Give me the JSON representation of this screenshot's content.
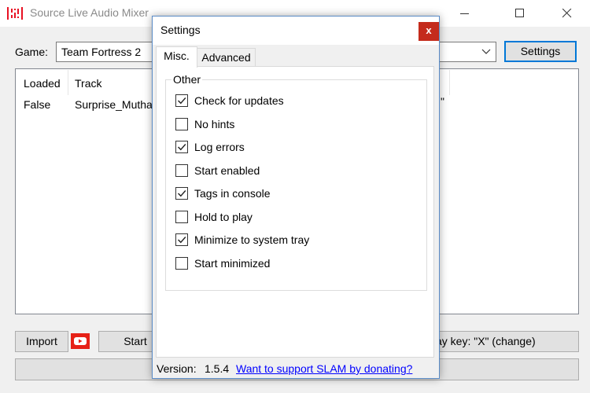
{
  "app": {
    "title": "Source Live Audio Mixer"
  },
  "main": {
    "game_label": "Game:",
    "game_value": "Team Fortress 2",
    "settings_button": "Settings",
    "track_list": {
      "headers": [
        "Loaded",
        "Track"
      ],
      "rows": [
        {
          "loaded": "False",
          "track": "Surprise_Muthaf",
          "trailing": "\""
        }
      ]
    },
    "import_button": "Import",
    "start_button": "Start",
    "relay_key": "ay key: \"X\" (change)"
  },
  "dialog": {
    "title": "Settings",
    "close_glyph": "x",
    "tabs": [
      "Misc.",
      "Advanced"
    ],
    "group_title": "Other",
    "options": [
      {
        "label": "Check for updates",
        "checked": true
      },
      {
        "label": "No hints",
        "checked": false
      },
      {
        "label": "Log errors",
        "checked": true
      },
      {
        "label": "Start enabled",
        "checked": false
      },
      {
        "label": "Tags in console",
        "checked": true
      },
      {
        "label": "Hold to play",
        "checked": false
      },
      {
        "label": "Minimize to system tray",
        "checked": true
      },
      {
        "label": "Start minimized",
        "checked": false
      }
    ],
    "version_label": "Version:",
    "version_value": "1.5.4",
    "donate_link": "Want to support SLAM by donating?"
  },
  "colors": {
    "accent": "#0078d7",
    "close_red": "#c42b1c",
    "link_blue": "#0000ff",
    "app_icon": "#e81123",
    "youtube_red": "#e62117"
  }
}
